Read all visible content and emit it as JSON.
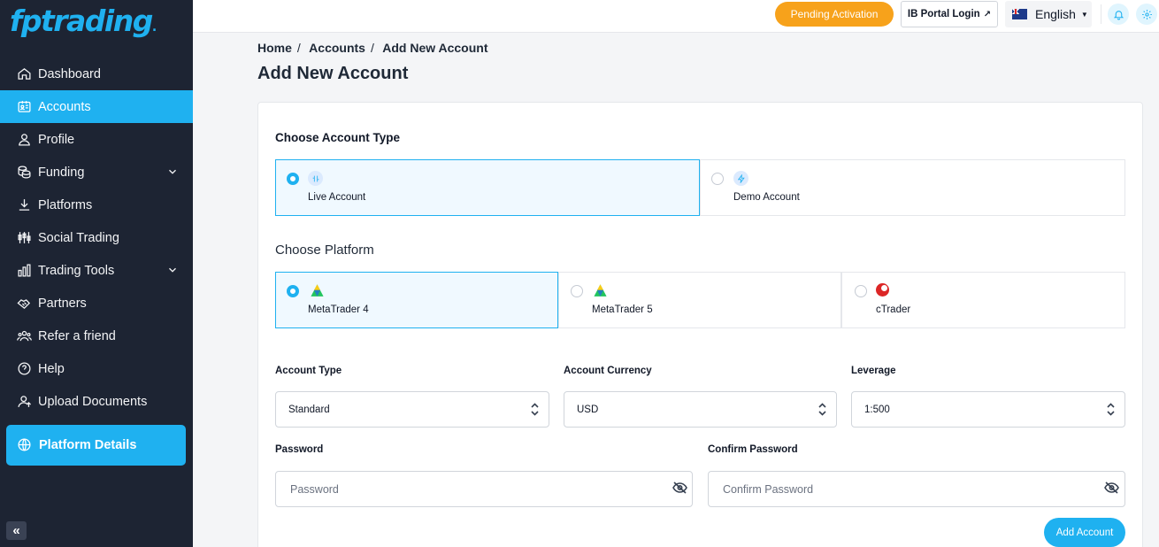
{
  "brand": {
    "logo_text": "fptrading",
    "logo_dot": ".",
    "accent": "#1fb1f0",
    "sidebar_bg": "#1d2433"
  },
  "sidebar": {
    "items": [
      {
        "label": "Dashboard",
        "icon": "home-icon"
      },
      {
        "label": "Accounts",
        "icon": "id-card-icon",
        "active": true
      },
      {
        "label": "Profile",
        "icon": "user-icon"
      },
      {
        "label": "Funding",
        "icon": "coins-icon",
        "expandable": true
      },
      {
        "label": "Platforms",
        "icon": "download-icon"
      },
      {
        "label": "Social Trading",
        "icon": "candlestick-icon"
      },
      {
        "label": "Trading Tools",
        "icon": "bar-chart-icon",
        "expandable": true
      },
      {
        "label": "Partners",
        "icon": "handshake-icon"
      },
      {
        "label": "Refer a friend",
        "icon": "users-icon"
      },
      {
        "label": "Help",
        "icon": "help-icon"
      },
      {
        "label": "Upload Documents",
        "icon": "user-upload-icon"
      }
    ],
    "platform_details": "Platform Details",
    "collapse_glyph": "«"
  },
  "topbar": {
    "pending": "Pending Activation",
    "pending_color": "#f7a21b",
    "ib_login": "IB Portal Login",
    "ib_login_icon": "external-link-icon",
    "language": "English",
    "language_flag": "australia-flag-icon"
  },
  "breadcrumb": [
    "Home",
    "Accounts",
    "Add New Account"
  ],
  "page_title": "Add New Account",
  "form": {
    "account_type_title": "Choose Account Type",
    "account_types": [
      {
        "label": "Live Account",
        "icon": "live-icon",
        "selected": true
      },
      {
        "label": "Demo Account",
        "icon": "bolt-icon",
        "selected": false
      }
    ],
    "platform_title": "Choose Platform",
    "platforms": [
      {
        "label": "MetaTrader 4",
        "icon": "metatrader-icon",
        "selected": true
      },
      {
        "label": "MetaTrader 5",
        "icon": "metatrader-icon",
        "selected": false
      },
      {
        "label": "cTrader",
        "icon": "ctrader-icon",
        "selected": false
      }
    ],
    "account_type_label": "Account Type",
    "account_type_value": "Standard",
    "currency_label": "Account Currency",
    "currency_value": "USD",
    "leverage_label": "Leverage",
    "leverage_value": "1:500",
    "password_label": "Password",
    "password_placeholder": "Password",
    "confirm_label": "Confirm Password",
    "confirm_placeholder": "Confirm Password",
    "submit": "Add Account"
  }
}
